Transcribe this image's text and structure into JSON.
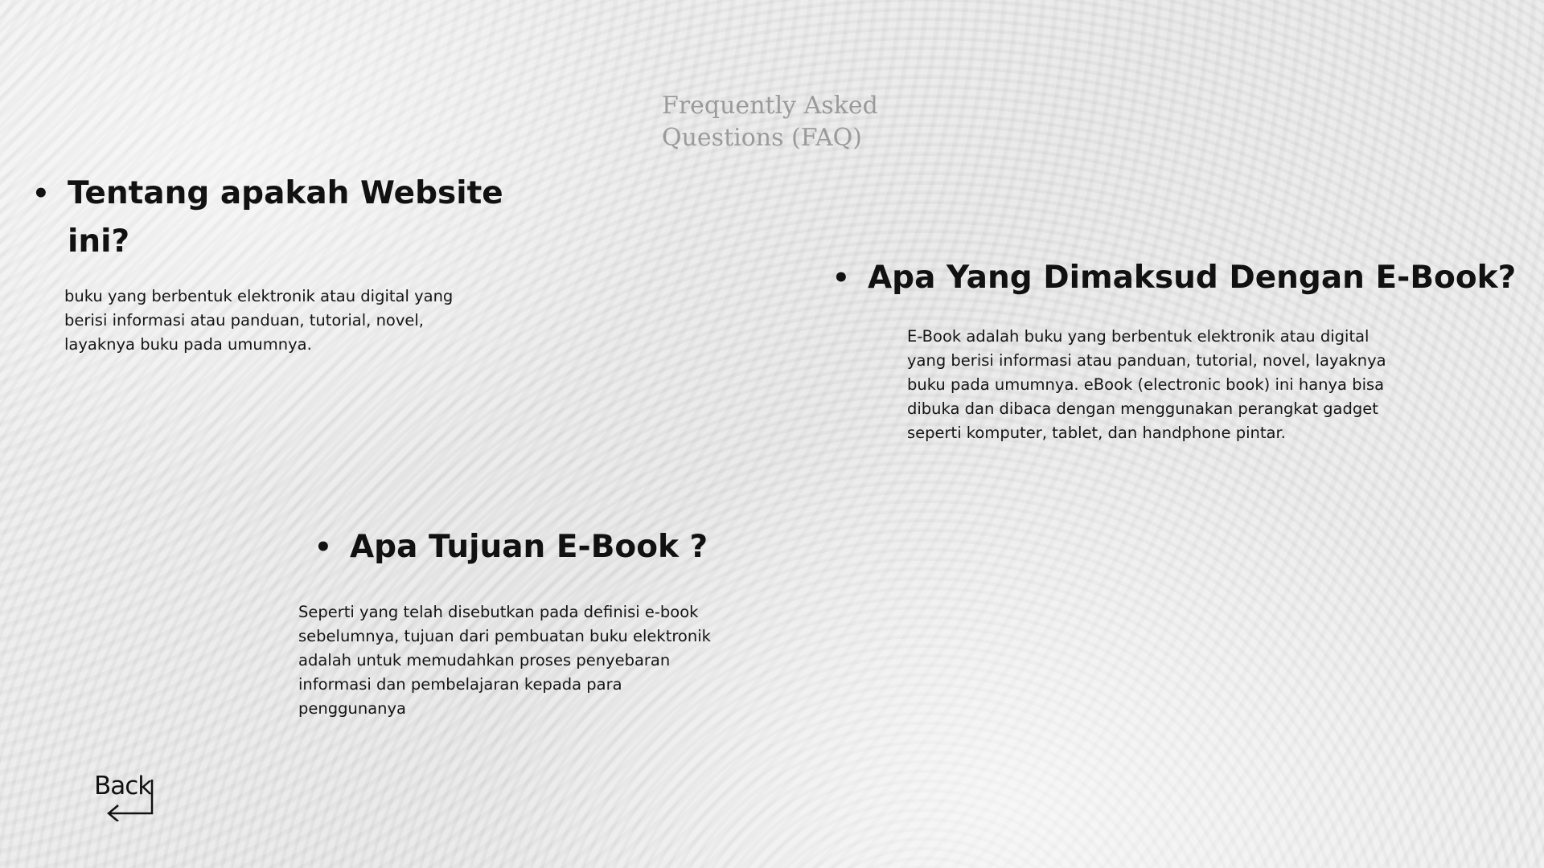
{
  "header": {
    "title": "Frequently Asked Questions (FAQ)"
  },
  "faq": [
    {
      "question": "Tentang apakah Website ini?",
      "answer": "buku yang berbentuk elektronik atau digital yang berisi informasi atau panduan, tutorial, novel, layaknya buku pada umumnya."
    },
    {
      "question": "Apa Yang Dimaksud Dengan E-Book?",
      "answer": "E-Book adalah buku yang berbentuk elektronik atau digital yang berisi informasi atau panduan, tutorial, novel, layaknya buku pada umumnya. eBook (electronic book) ini hanya bisa dibuka dan dibaca dengan menggunakan perangkat gadget seperti komputer, tablet, dan handphone pintar."
    },
    {
      "question": "Apa Tujuan E-Book ?",
      "answer": "Seperti yang telah disebutkan pada definisi e-book sebelumnya, tujuan dari pembuatan buku elektronik adalah untuk memudahkan proses penyebaran informasi dan pembelajaran kepada para penggunanya"
    }
  ],
  "nav": {
    "back_label": "Back",
    "back_icon": "return-arrow-icon"
  },
  "colors": {
    "title": "#9a9a9a",
    "text": "#111111",
    "background": "#eeeeee"
  }
}
